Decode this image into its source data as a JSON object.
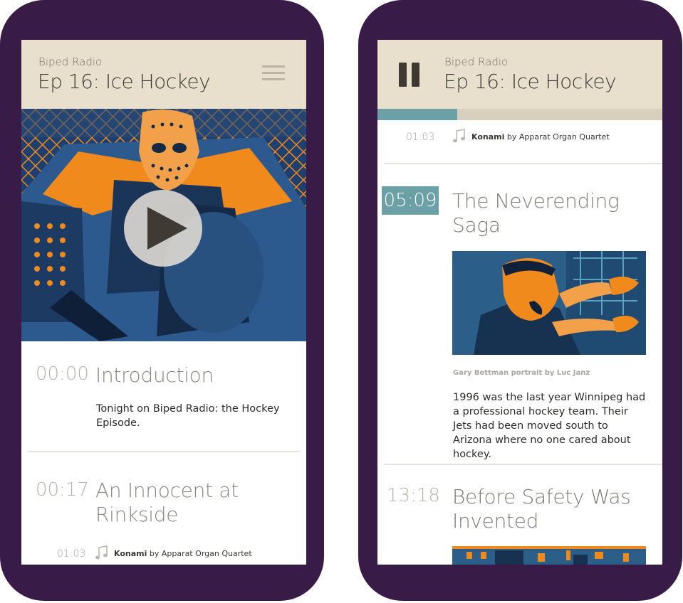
{
  "left": {
    "podcast_name": "Biped Radio",
    "episode_title": "Ep 16: Ice Hockey",
    "chapters": [
      {
        "time": "00:00",
        "title": "Introduction",
        "text": "Tonight on Biped Radio: the Hockey Episode."
      },
      {
        "time": "00:17",
        "title": "An Innocent at Rinkside"
      }
    ],
    "track": {
      "time": "01:03",
      "song": "Konami",
      "by": "by Apparat Organ Quartet"
    }
  },
  "right": {
    "podcast_name": "Biped Radio",
    "episode_title": "Ep 16: Ice Hockey",
    "progress": 0.28,
    "track": {
      "time": "01:03",
      "song": "Konami",
      "by": "by Apparat Organ Quartet"
    },
    "chapters": [
      {
        "time": "05:09",
        "title": "The Neverending Saga",
        "caption": "Gary Bettman portrait by Luc Janz",
        "text": "1996 was the last year Winnipeg had a professional hockey team. Their Jets had been moved south to Arizona where no one cared about hockey."
      },
      {
        "time": "13:18",
        "title": "Before Safety Was Invented"
      }
    ]
  },
  "colors": {
    "phone": "#381b47",
    "header": "#e9dfcd",
    "accent": "#6aa0a6",
    "orange": "#f08a1c",
    "blue": "#2a5c8c"
  }
}
